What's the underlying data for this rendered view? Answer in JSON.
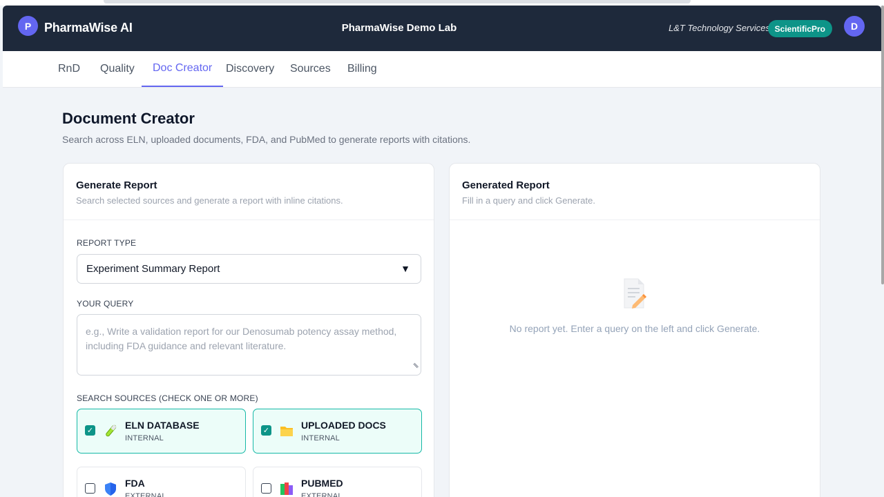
{
  "header": {
    "logo_letter": "P",
    "app_name": "PharmaWise AI",
    "lab_name": "PharmaWise Demo Lab",
    "company": "L&T Technology Services",
    "plan_badge": "ScientificPro",
    "user_initial": "D"
  },
  "tabs": [
    {
      "label": "RnD",
      "active": false
    },
    {
      "label": "Quality",
      "active": false
    },
    {
      "label": "Doc Creator",
      "active": true
    },
    {
      "label": "Discovery",
      "active": false
    },
    {
      "label": "Sources",
      "active": false
    },
    {
      "label": "Billing",
      "active": false
    }
  ],
  "page": {
    "title": "Document Creator",
    "subtitle": "Search across ELN, uploaded documents, FDA, and PubMed to generate reports with citations."
  },
  "generate_card": {
    "title": "Generate Report",
    "subtitle": "Search selected sources and generate a report with inline citations.",
    "report_type_label": "REPORT TYPE",
    "report_type_value": "Experiment Summary Report",
    "query_label": "YOUR QUERY",
    "query_placeholder": "e.g., Write a validation report for our Denosumab potency assay method, including FDA guidance and relevant literature.",
    "sources_label": "SEARCH SOURCES (CHECK ONE OR MORE)",
    "sources": [
      {
        "name": "ELN DATABASE",
        "type": "INTERNAL",
        "checked": true,
        "icon": "test-tube-icon"
      },
      {
        "name": "UPLOADED DOCS",
        "type": "INTERNAL",
        "checked": true,
        "icon": "folder-icon"
      },
      {
        "name": "FDA",
        "type": "EXTERNAL",
        "checked": false,
        "icon": "shield-icon"
      },
      {
        "name": "PUBMED",
        "type": "EXTERNAL",
        "checked": false,
        "icon": "books-icon"
      }
    ]
  },
  "report_card": {
    "title": "Generated Report",
    "subtitle": "Fill in a query and click Generate.",
    "empty_text": "No report yet. Enter a query on the left and click Generate.",
    "empty_icon": "memo-icon"
  },
  "colors": {
    "header_bg": "#1e293b",
    "accent": "#6366f1",
    "teal": "#0d9488"
  }
}
